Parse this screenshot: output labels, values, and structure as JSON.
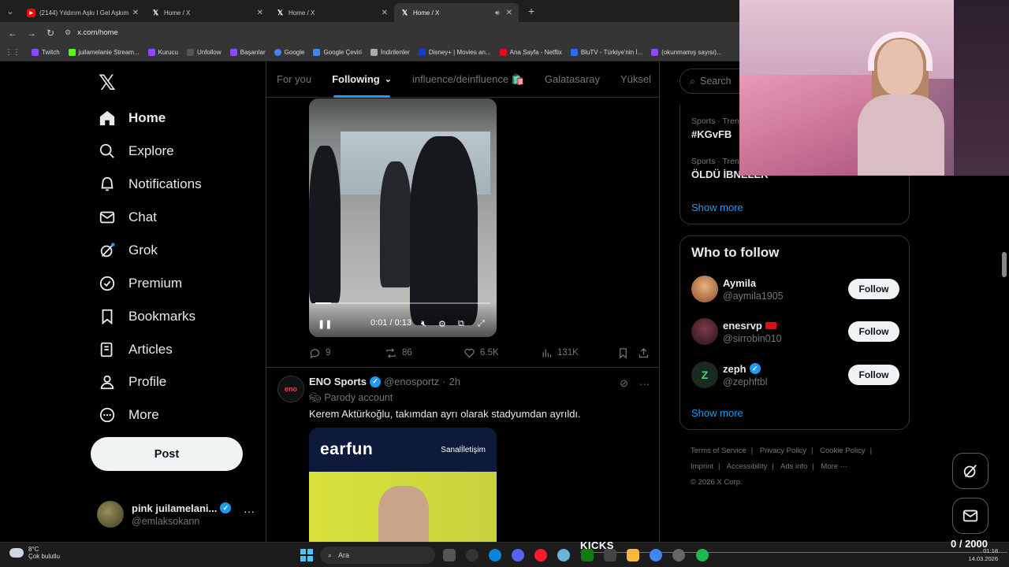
{
  "browser": {
    "tabs": [
      {
        "title": "(2144) Yıldırım Aşkı I Gel Aşkım",
        "favicon": "youtube-icon"
      },
      {
        "title": "Home / X",
        "favicon": "x-icon"
      },
      {
        "title": "Home / X",
        "favicon": "x-icon"
      },
      {
        "title": "Home / X",
        "favicon": "x-icon",
        "active": true
      }
    ],
    "url": "x.com/home",
    "bookmarks": [
      "Twitch",
      "juilamelanie Stream...",
      "Kurucu",
      "Unfollow",
      "Başarılar",
      "Google",
      "Google Çeviri",
      "İndirilenler",
      "Disney+ | Movies an...",
      "Ana Sayfa - Netflix",
      "BluTV - Türkiye'nin İ...",
      "(okunmamış sayısı)..."
    ]
  },
  "nav": {
    "items": [
      {
        "label": "Home",
        "icon": "home-icon"
      },
      {
        "label": "Explore",
        "icon": "search-icon"
      },
      {
        "label": "Notifications",
        "icon": "bell-icon"
      },
      {
        "label": "Chat",
        "icon": "mail-icon"
      },
      {
        "label": "Grok",
        "icon": "grok-icon"
      },
      {
        "label": "Premium",
        "icon": "verified-icon"
      },
      {
        "label": "Bookmarks",
        "icon": "bookmark-icon"
      },
      {
        "label": "Articles",
        "icon": "articles-icon"
      },
      {
        "label": "Profile",
        "icon": "profile-icon"
      },
      {
        "label": "More",
        "icon": "more-icon"
      }
    ],
    "post_label": "Post",
    "account": {
      "name": "pink juilamelani...",
      "handle": "@emlaksokann"
    }
  },
  "feed": {
    "tabs": [
      "For you",
      "Following",
      "influence/deinfluence 🛍️",
      "Galatasaray",
      "Yüksel"
    ],
    "video": {
      "time": "0:01 / 0:13",
      "progress": 0.09
    },
    "actions": {
      "replies": "9",
      "reposts": "86",
      "likes": "6.5K",
      "views": "131K"
    },
    "tweet2": {
      "name": "ENO Sports",
      "handle": "@enosportz",
      "time": "2h",
      "parody": "Parody account",
      "text": "Kerem Aktürkoğlu, takımdan ayrı olarak stadyumdan ayrıldı.",
      "avatar_text": "eno",
      "image_brand1": "earfun",
      "image_brand2": "Sanalİletişim"
    }
  },
  "right": {
    "search_placeholder": "Search",
    "trends": [
      {
        "category": "Sports · Trending",
        "name": "#KGvFB"
      },
      {
        "category": "Sports · Trending",
        "name": "ÖLDÜ İBNELER"
      }
    ],
    "show_more": "Show more",
    "who_to_follow": "Who to follow",
    "follow_label": "Follow",
    "suggestions": [
      {
        "name": "Aymila",
        "handle": "@aymila1905"
      },
      {
        "name": "enesrvp",
        "handle": "@sirrobin010"
      },
      {
        "name": "zeph",
        "handle": "@zephftbl"
      }
    ],
    "footer": [
      "Terms of Service",
      "Privacy Policy",
      "Cookie Policy",
      "Imprint",
      "Accessibility",
      "Ads info",
      "More ···",
      "© 2026 X Corp."
    ]
  },
  "taskbar": {
    "weather_temp": "8°C",
    "weather_desc": "Çok bulutlu",
    "search": "Ara",
    "kicks": "KICKS",
    "counter": "0  / 2000",
    "time": "01:18",
    "date": "14.03.2026"
  },
  "colors": {
    "accent": "#1d9bf0",
    "background": "#000000",
    "border": "#2f3336"
  }
}
